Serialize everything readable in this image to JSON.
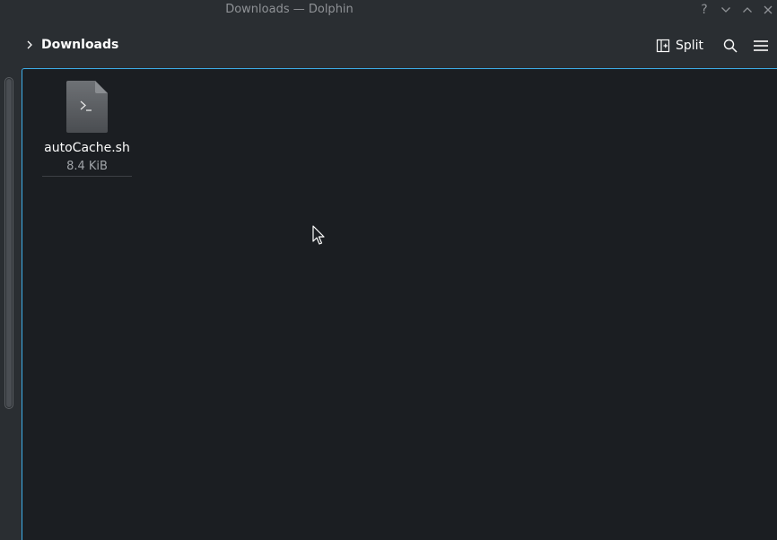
{
  "window": {
    "title": "Downloads — Dolphin",
    "buttons": {
      "help": "help-icon",
      "minimize": "chevron-down-icon",
      "maximize": "chevron-up-icon",
      "close": "close-icon"
    }
  },
  "toolbar": {
    "breadcrumb": {
      "chevron_icon": "chevron-right-icon",
      "label": "Downloads"
    },
    "split_label": "Split",
    "search_icon": "search-icon",
    "menu_icon": "hamburger-menu-icon"
  },
  "files": [
    {
      "name": "autoCache.sh",
      "size": "8.4 KiB",
      "icon": "shell-script-file-icon"
    }
  ],
  "colors": {
    "background": "#2a2e32",
    "view_background": "#1b1e22",
    "focus_accent": "#3daee9",
    "text": "#fcfcfc",
    "muted_text": "#8f9296"
  }
}
